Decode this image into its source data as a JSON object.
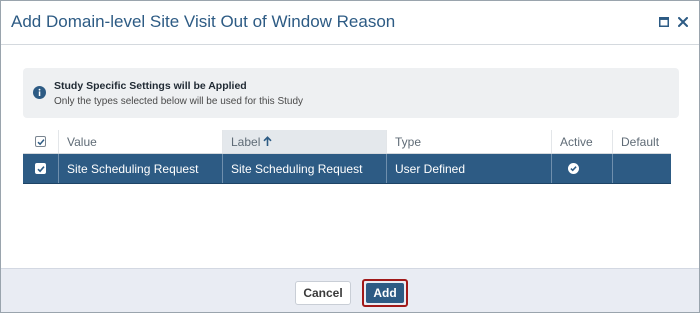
{
  "dialog": {
    "title": "Add Domain-level Site Visit Out of Window Reason",
    "maximize_icon": "maximize-icon",
    "close_icon": "close-icon"
  },
  "notice": {
    "icon": "info-icon",
    "title": "Study Specific Settings will be Applied",
    "subtitle": "Only the types selected below will be used for this Study"
  },
  "grid": {
    "columns": [
      "Value",
      "Label",
      "Type",
      "Active",
      "Default"
    ],
    "sorted_column": "Label",
    "sort_direction": "ascending",
    "select_all_checked": true,
    "rows": [
      {
        "selected": true,
        "value": "Site Scheduling Request",
        "label": "Site Scheduling Request",
        "type": "User Defined",
        "active": true,
        "default": false
      }
    ]
  },
  "footer": {
    "cancel_label": "Cancel",
    "add_label": "Add"
  },
  "colors": {
    "accent": "#2d5b84",
    "highlight_border": "#a01919",
    "footer_bg": "#e9ecf3"
  }
}
